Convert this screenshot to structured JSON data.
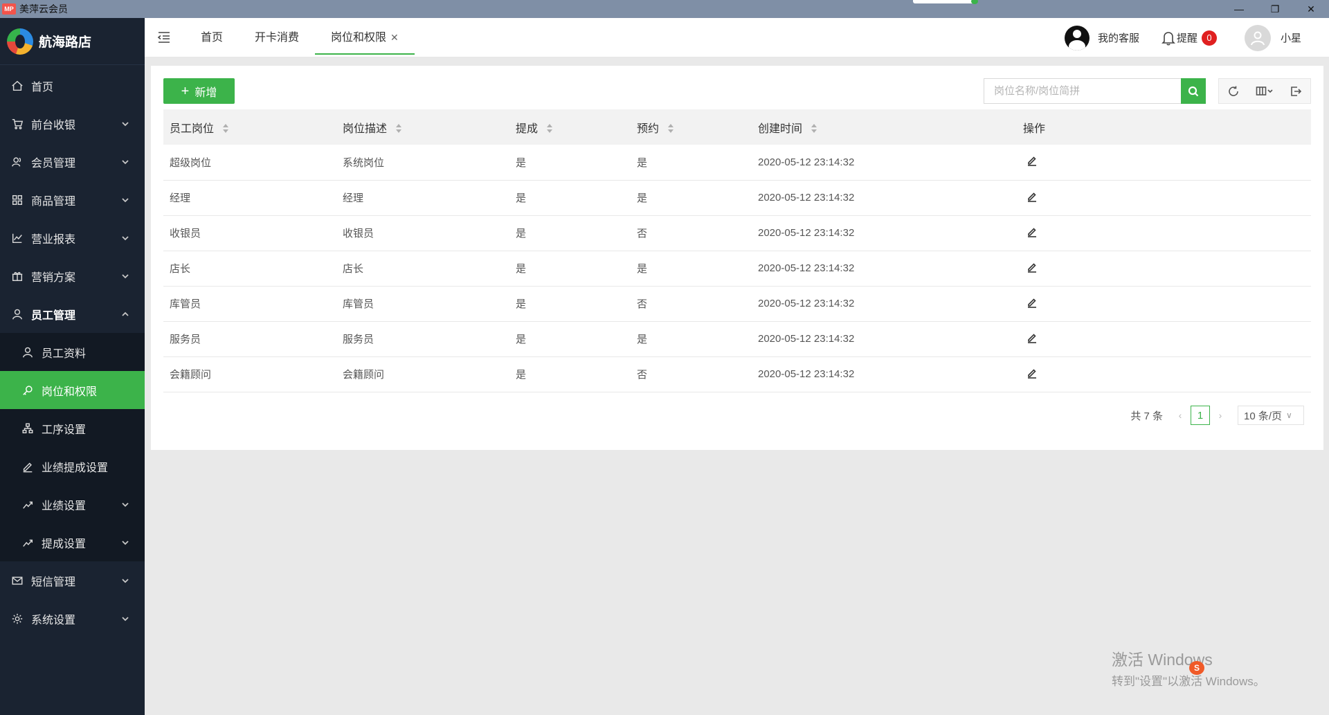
{
  "window": {
    "app_logo": "MP",
    "title": "美萍云会员",
    "controls": {
      "minimize": "—",
      "restore": "❐",
      "close": "✕"
    }
  },
  "sidebar": {
    "brand": "航海路店",
    "items": [
      {
        "label": "首页",
        "icon": "home-icon",
        "has_children": false
      },
      {
        "label": "前台收银",
        "icon": "cart-icon",
        "has_children": true
      },
      {
        "label": "会员管理",
        "icon": "members-icon",
        "has_children": true
      },
      {
        "label": "商品管理",
        "icon": "grid-icon",
        "has_children": true
      },
      {
        "label": "营业报表",
        "icon": "chart-icon",
        "has_children": true
      },
      {
        "label": "营销方案",
        "icon": "gift-icon",
        "has_children": true
      },
      {
        "label": "员工管理",
        "icon": "user-icon",
        "has_children": true,
        "open": true
      },
      {
        "label": "短信管理",
        "icon": "mail-icon",
        "has_children": true
      },
      {
        "label": "系统设置",
        "icon": "gear-icon",
        "has_children": true
      }
    ],
    "staff_submenu": [
      {
        "label": "员工资料",
        "icon": "user-icon"
      },
      {
        "label": "岗位和权限",
        "icon": "key-icon",
        "active": true
      },
      {
        "label": "工序设置",
        "icon": "hierarchy-icon"
      },
      {
        "label": "业绩提成设置",
        "icon": "pen-icon"
      },
      {
        "label": "业绩设置",
        "icon": "trend-icon",
        "has_children": true
      },
      {
        "label": "提成设置",
        "icon": "trend-icon",
        "has_children": true
      }
    ]
  },
  "header": {
    "tabs": [
      {
        "label": "首页"
      },
      {
        "label": "开卡消费"
      },
      {
        "label": "岗位和权限",
        "active": true,
        "close": "✕"
      }
    ],
    "customer_service": "我的客服",
    "reminder": "提醒",
    "reminder_count": "0",
    "user_name": "小星"
  },
  "toolbar": {
    "add_label": "新增",
    "add_icon": "+",
    "search_placeholder": "岗位名称/岗位简拼"
  },
  "table": {
    "columns": [
      "员工岗位",
      "岗位描述",
      "提成",
      "预约",
      "创建时间",
      "操作"
    ],
    "rows": [
      {
        "position": "超级岗位",
        "desc": "系统岗位",
        "commission": "是",
        "booking": "是",
        "created": "2020-05-12 23:14:32"
      },
      {
        "position": "经理",
        "desc": "经理",
        "commission": "是",
        "booking": "是",
        "created": "2020-05-12 23:14:32"
      },
      {
        "position": "收银员",
        "desc": "收银员",
        "commission": "是",
        "booking": "否",
        "created": "2020-05-12 23:14:32"
      },
      {
        "position": "店长",
        "desc": "店长",
        "commission": "是",
        "booking": "是",
        "created": "2020-05-12 23:14:32"
      },
      {
        "position": "库管员",
        "desc": "库管员",
        "commission": "是",
        "booking": "否",
        "created": "2020-05-12 23:14:32"
      },
      {
        "position": "服务员",
        "desc": "服务员",
        "commission": "是",
        "booking": "是",
        "created": "2020-05-12 23:14:32"
      },
      {
        "position": "会籍顾问",
        "desc": "会籍顾问",
        "commission": "是",
        "booking": "否",
        "created": "2020-05-12 23:14:32"
      }
    ]
  },
  "pager": {
    "total": "共 7 条",
    "prev": "‹",
    "current_page": "1",
    "next": "›",
    "page_size": "10 条/页",
    "page_size_caret": "∨"
  },
  "watermark": {
    "line1": "激活 Windows",
    "line2": "转到\"设置\"以激活 Windows。",
    "ime": "S"
  },
  "colors": {
    "accent": "#3cb34a",
    "sidebar_bg": "#1a2331",
    "submenu_bg": "#121923",
    "badge": "#e02020"
  }
}
